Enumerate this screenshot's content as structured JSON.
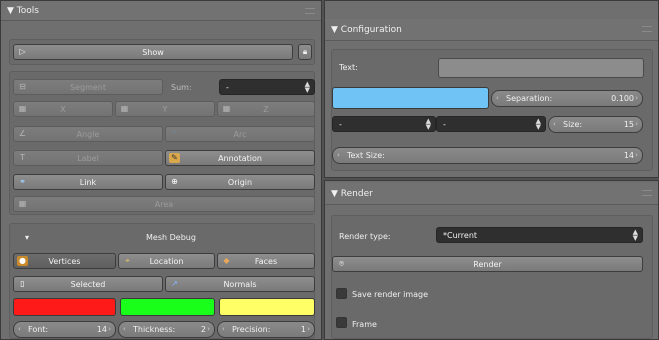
{
  "tools": {
    "title": "▼ Tools",
    "show_label": "Show",
    "segment_label": "Segment",
    "sum_label": "Sum:",
    "sum_value": "-",
    "x_label": "X",
    "y_label": "Y",
    "z_label": "Z",
    "angle_label": "Angle",
    "arc_label": "Arc",
    "label_label": "Label",
    "annotation_label": "Annotation",
    "link_label": "Link",
    "origin_label": "Origin",
    "area_label": "Area"
  },
  "mesh_debug": {
    "title": "Mesh Debug",
    "vertices_label": "Vertices",
    "location_label": "Location",
    "faces_label": "Faces",
    "selected_label": "Selected",
    "normals_label": "Normals",
    "swatch_colors": [
      "#ff1a1a",
      "#1aff1a",
      "#ffff66"
    ],
    "font_label": "Font:",
    "font_value": "14",
    "thickness_label": "Thickness:",
    "thickness_value": "2",
    "precision_label": "Precision:",
    "precision_value": "1"
  },
  "configuration": {
    "title": "▼ Configuration",
    "text_label": "Text:",
    "text_value": "",
    "color_value": "#6fc3f5",
    "separation_label": "Separation:",
    "separation_value": "0.100",
    "drop1_value": "-",
    "drop2_value": "-",
    "size_label": "Size:",
    "size_value": "15",
    "text_size_label": "Text Size:",
    "text_size_value": "14"
  },
  "render": {
    "title": "▼ Render",
    "render_type_label": "Render type:",
    "render_type_value": "*Current",
    "render_button": "Render",
    "save_image_label": "Save render image",
    "frame_label": "Frame"
  }
}
